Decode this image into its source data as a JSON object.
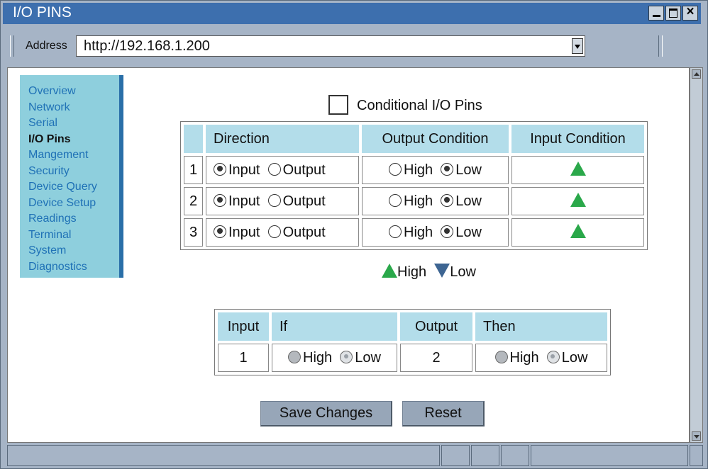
{
  "window": {
    "title": "I/O PINS"
  },
  "address": {
    "label": "Address",
    "url": "http://192.168.1.200"
  },
  "nav": {
    "items": [
      {
        "label": "Overview",
        "active": false
      },
      {
        "label": "Network",
        "active": false
      },
      {
        "label": "Serial",
        "active": false
      },
      {
        "label": "I/O Pins",
        "active": true
      },
      {
        "label": "Mangement",
        "active": false
      },
      {
        "label": "Security",
        "active": false
      },
      {
        "label": "Device Query",
        "active": false
      },
      {
        "label": "Device Setup",
        "active": false
      },
      {
        "label": "Readings",
        "active": false
      },
      {
        "label": "Terminal",
        "active": false
      },
      {
        "label": "System",
        "active": false
      },
      {
        "label": "Diagnostics",
        "active": false
      }
    ]
  },
  "conditional": {
    "label": "Conditional I/O Pins",
    "checked": false
  },
  "pins_table": {
    "headers": {
      "direction": "Direction",
      "output_condition": "Output Condition",
      "input_condition": "Input Condition"
    },
    "rows": [
      {
        "num": "1",
        "input": "Input",
        "output": "Output",
        "high": "High",
        "low": "Low",
        "direction": "Input",
        "output_state": "Low",
        "input_state": "High"
      },
      {
        "num": "2",
        "input": "Input",
        "output": "Output",
        "high": "High",
        "low": "Low",
        "direction": "Input",
        "output_state": "Low",
        "input_state": "High"
      },
      {
        "num": "3",
        "input": "Input",
        "output": "Output",
        "high": "High",
        "low": "Low",
        "direction": "Input",
        "output_state": "Low",
        "input_state": "High"
      }
    ]
  },
  "legend": {
    "high": "High",
    "low": "Low",
    "high_color": "#2aa84a",
    "low_color": "#3d6592"
  },
  "cond_table": {
    "headers": {
      "input": "Input",
      "if": "If",
      "output": "Output",
      "then": "Then"
    },
    "row": {
      "input": "1",
      "if_high": "High",
      "if_low": "Low",
      "if_selected": "Low",
      "output": "2",
      "then_high": "High",
      "then_low": "Low",
      "then_selected": "Low"
    }
  },
  "buttons": {
    "save": "Save Changes",
    "reset": "Reset"
  },
  "colors": {
    "titlebar": "#3d6fae",
    "header_cell": "#b3ddea",
    "nav_bg": "#8ecfdd",
    "nav_link": "#1f71b6"
  }
}
